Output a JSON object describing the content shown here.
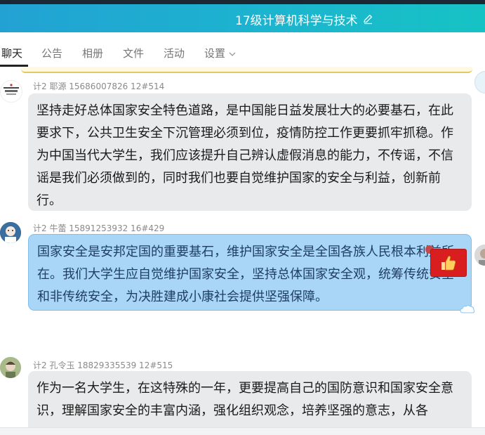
{
  "window": {
    "title": "17级计算机科学与技术",
    "accent_color": "#22a2d3"
  },
  "tabs": [
    {
      "label": "聊天",
      "active": true
    },
    {
      "label": "公告",
      "active": false
    },
    {
      "label": "相册",
      "active": false
    },
    {
      "label": "文件",
      "active": false
    },
    {
      "label": "活动",
      "active": false
    },
    {
      "label": "设置",
      "active": false,
      "icon": "chevron-down-icon"
    }
  ],
  "messages": [
    {
      "sender": "计2 耶源 15686007826 12#514",
      "text": "坚持走好总体国家安全特色道路，是中国能日益发展壮大的必要基石，在此要求下，公共卫生安全下沉管理必须到位，疫情防控工作更要抓牢抓稳。作为中国当代大学生，我们应该提升自己辨认虚假消息的能力，不传谣，不信谣是我们必须做到的，同时我们也要自觉维护国家的安全与利益，创新前行。",
      "bubble_color": "#e9eaeb"
    },
    {
      "sender": "计2 牛蕾 15891253932 16#429",
      "text": "国家安全是安邦定国的重要基石，维护国家安全是全国各族人民根本利益所在。我们大学生应自觉维护国家安全，坚持总体国家安全观，统筹传统安全和非传统安全，为决胜建成小康社会提供坚强保障。",
      "bubble_color": "#a9d6f6"
    },
    {
      "sender": "计2 孔令玉 18829335539 12#515",
      "text": "作为一名大学生，在这特殊的一年，更要提高自己的国防意识和国家安全意识，理解国家安全的丰富内涵，强化组织观念，培养坚强的意志，从各",
      "bubble_color": "#e9eaeb"
    }
  ],
  "sticker": {
    "icon": "thumbs-up-icon",
    "color": "#d81e1e"
  }
}
